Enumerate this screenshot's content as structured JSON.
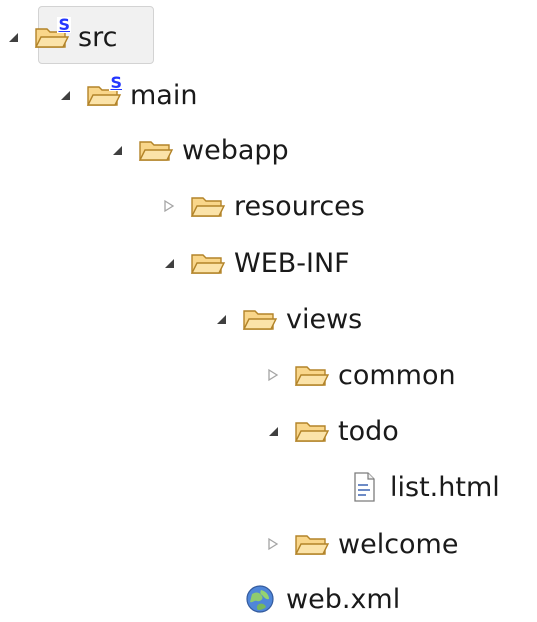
{
  "tree": {
    "items": [
      {
        "label": "src",
        "state": "expanded",
        "icon": "source-folder-icon",
        "selected": true
      },
      {
        "label": "main",
        "state": "expanded",
        "icon": "source-folder-icon"
      },
      {
        "label": "webapp",
        "state": "expanded",
        "icon": "folder-icon"
      },
      {
        "label": "resources",
        "state": "collapsed",
        "icon": "folder-icon"
      },
      {
        "label": "WEB-INF",
        "state": "expanded",
        "icon": "folder-icon"
      },
      {
        "label": "views",
        "state": "expanded",
        "icon": "folder-icon"
      },
      {
        "label": "common",
        "state": "collapsed",
        "icon": "folder-icon"
      },
      {
        "label": "todo",
        "state": "expanded",
        "icon": "folder-icon"
      },
      {
        "label": "list.html",
        "state": "leaf",
        "icon": "html-file-icon"
      },
      {
        "label": "welcome",
        "state": "collapsed",
        "icon": "folder-icon"
      },
      {
        "label": "web.xml",
        "state": "leaf",
        "icon": "xml-file-icon"
      }
    ]
  },
  "colors": {
    "folder_fill": "#F9D68A",
    "folder_stroke": "#B38429",
    "expanded_triangle": "#404040",
    "collapsed_triangle": "#A5A5A5",
    "source_badge": "#2437FF",
    "selection": "#F1F1F1"
  },
  "badge": "S"
}
